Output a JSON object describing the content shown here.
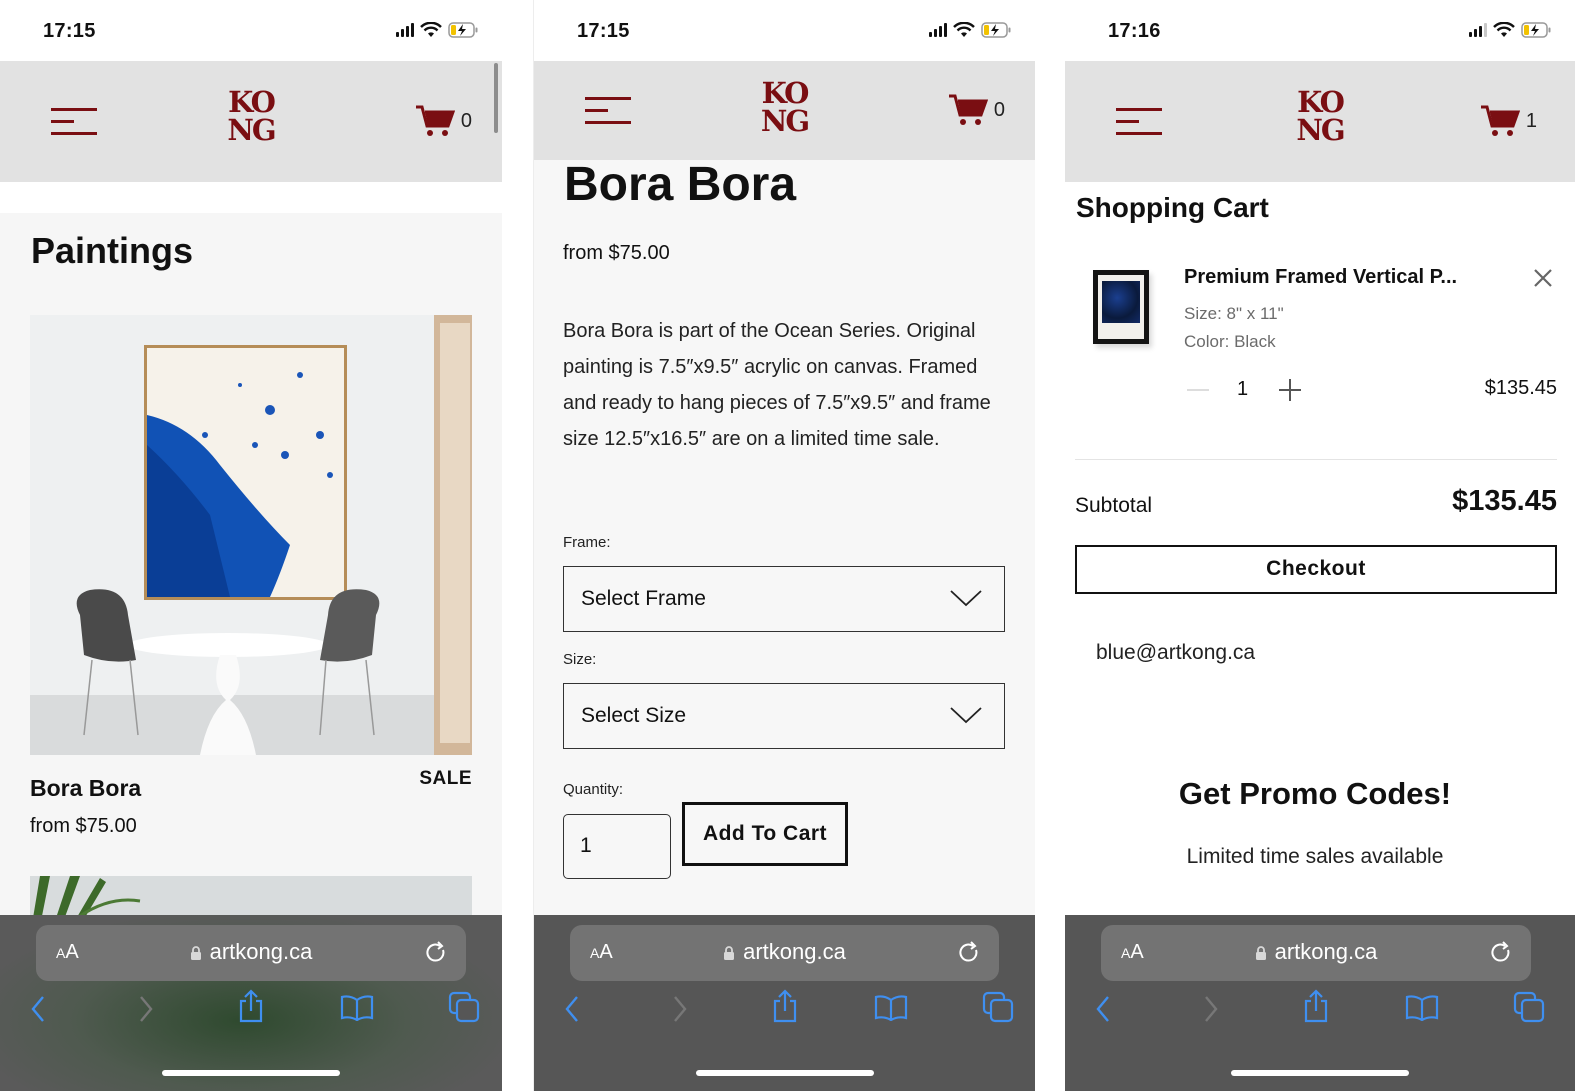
{
  "screens": [
    {
      "status": {
        "time": "17:15"
      },
      "header": {
        "logo_top": "KO",
        "logo_bottom": "NG",
        "cart_count": "0"
      },
      "page": {
        "title": "Paintings",
        "products": [
          {
            "name": "Bora Bora",
            "badge": "SALE",
            "price": "from $75.00"
          }
        ]
      },
      "browser": {
        "text_size": "AA",
        "url": "artkong.ca"
      }
    },
    {
      "status": {
        "time": "17:15"
      },
      "header": {
        "logo_top": "KO",
        "logo_bottom": "NG",
        "cart_count": "0"
      },
      "product": {
        "title": "Bora Bora",
        "price": "from $75.00",
        "description": "Bora Bora is part of the Ocean Series. Original painting is 7.5″x9.5″ acrylic on canvas. Framed and ready to hang pieces of 7.5″x9.5″ and frame size 12.5″x16.5″ are on a limited time sale.",
        "frame_label": "Frame:",
        "frame_value": "Select Frame",
        "size_label": "Size:",
        "size_value": "Select Size",
        "quantity_label": "Quantity:",
        "quantity_value": "1",
        "add_to_cart": "Add To Cart"
      },
      "browser": {
        "text_size": "AA",
        "url": "artkong.ca"
      }
    },
    {
      "status": {
        "time": "17:16"
      },
      "header": {
        "logo_top": "KO",
        "logo_bottom": "NG",
        "cart_count": "1"
      },
      "cart": {
        "title": "Shopping Cart",
        "items": [
          {
            "name": "Premium Framed Vertical P...",
            "size": "Size: 8\" x 11\"",
            "color": "Color: Black",
            "quantity": "1",
            "price": "$135.45"
          }
        ],
        "subtotal_label": "Subtotal",
        "subtotal_value": "$135.45",
        "checkout": "Checkout",
        "email": "blue@artkong.ca",
        "promo_title": "Get Promo Codes!",
        "promo_subtitle": "Limited time sales available"
      },
      "browser": {
        "text_size": "AA",
        "url": "artkong.ca"
      }
    }
  ],
  "colors": {
    "brand": "#7a0e12",
    "safari_blue": "#3f8ff0",
    "header_bg": "#e2e2e2"
  }
}
